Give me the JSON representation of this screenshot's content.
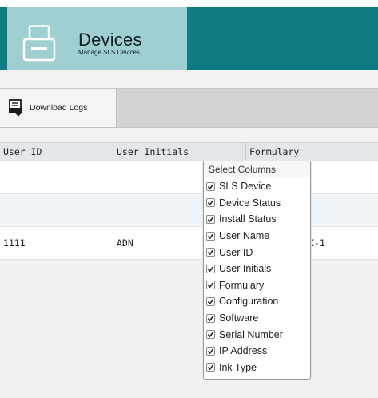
{
  "header": {
    "title": "Devices",
    "subtitle": "Manage SLS Devices",
    "icon": "device-printer-icon",
    "colors": {
      "band": "#0f7a80",
      "tile": "#9fcfd0"
    }
  },
  "toolbar": {
    "download_logs_label": "Download Logs",
    "download_icon": "download-logs-icon"
  },
  "grid": {
    "columns": [
      "User ID",
      "User Initials",
      "Formulary"
    ],
    "rows": [
      {
        "user_id": "",
        "user_initials": "",
        "formulary": "",
        "extra": ""
      },
      {
        "user_id": "",
        "user_initials": "",
        "formulary": "",
        "extra": ""
      },
      {
        "user_id": "1111",
        "user_initials": "ADN",
        "formulary": "",
        "extra": "K-1"
      }
    ]
  },
  "column_picker": {
    "title": "Select Columns",
    "options": [
      {
        "label": "SLS Device",
        "checked": true
      },
      {
        "label": "Device Status",
        "checked": true
      },
      {
        "label": "Install Status",
        "checked": true
      },
      {
        "label": "User Name",
        "checked": true
      },
      {
        "label": "User ID",
        "checked": true
      },
      {
        "label": "User Initials",
        "checked": true
      },
      {
        "label": "Formulary",
        "checked": true
      },
      {
        "label": "Configuration",
        "checked": true
      },
      {
        "label": "Software",
        "checked": true
      },
      {
        "label": "Serial Number",
        "checked": true
      },
      {
        "label": "IP Address",
        "checked": true
      },
      {
        "label": "Ink Type",
        "checked": true
      }
    ]
  }
}
